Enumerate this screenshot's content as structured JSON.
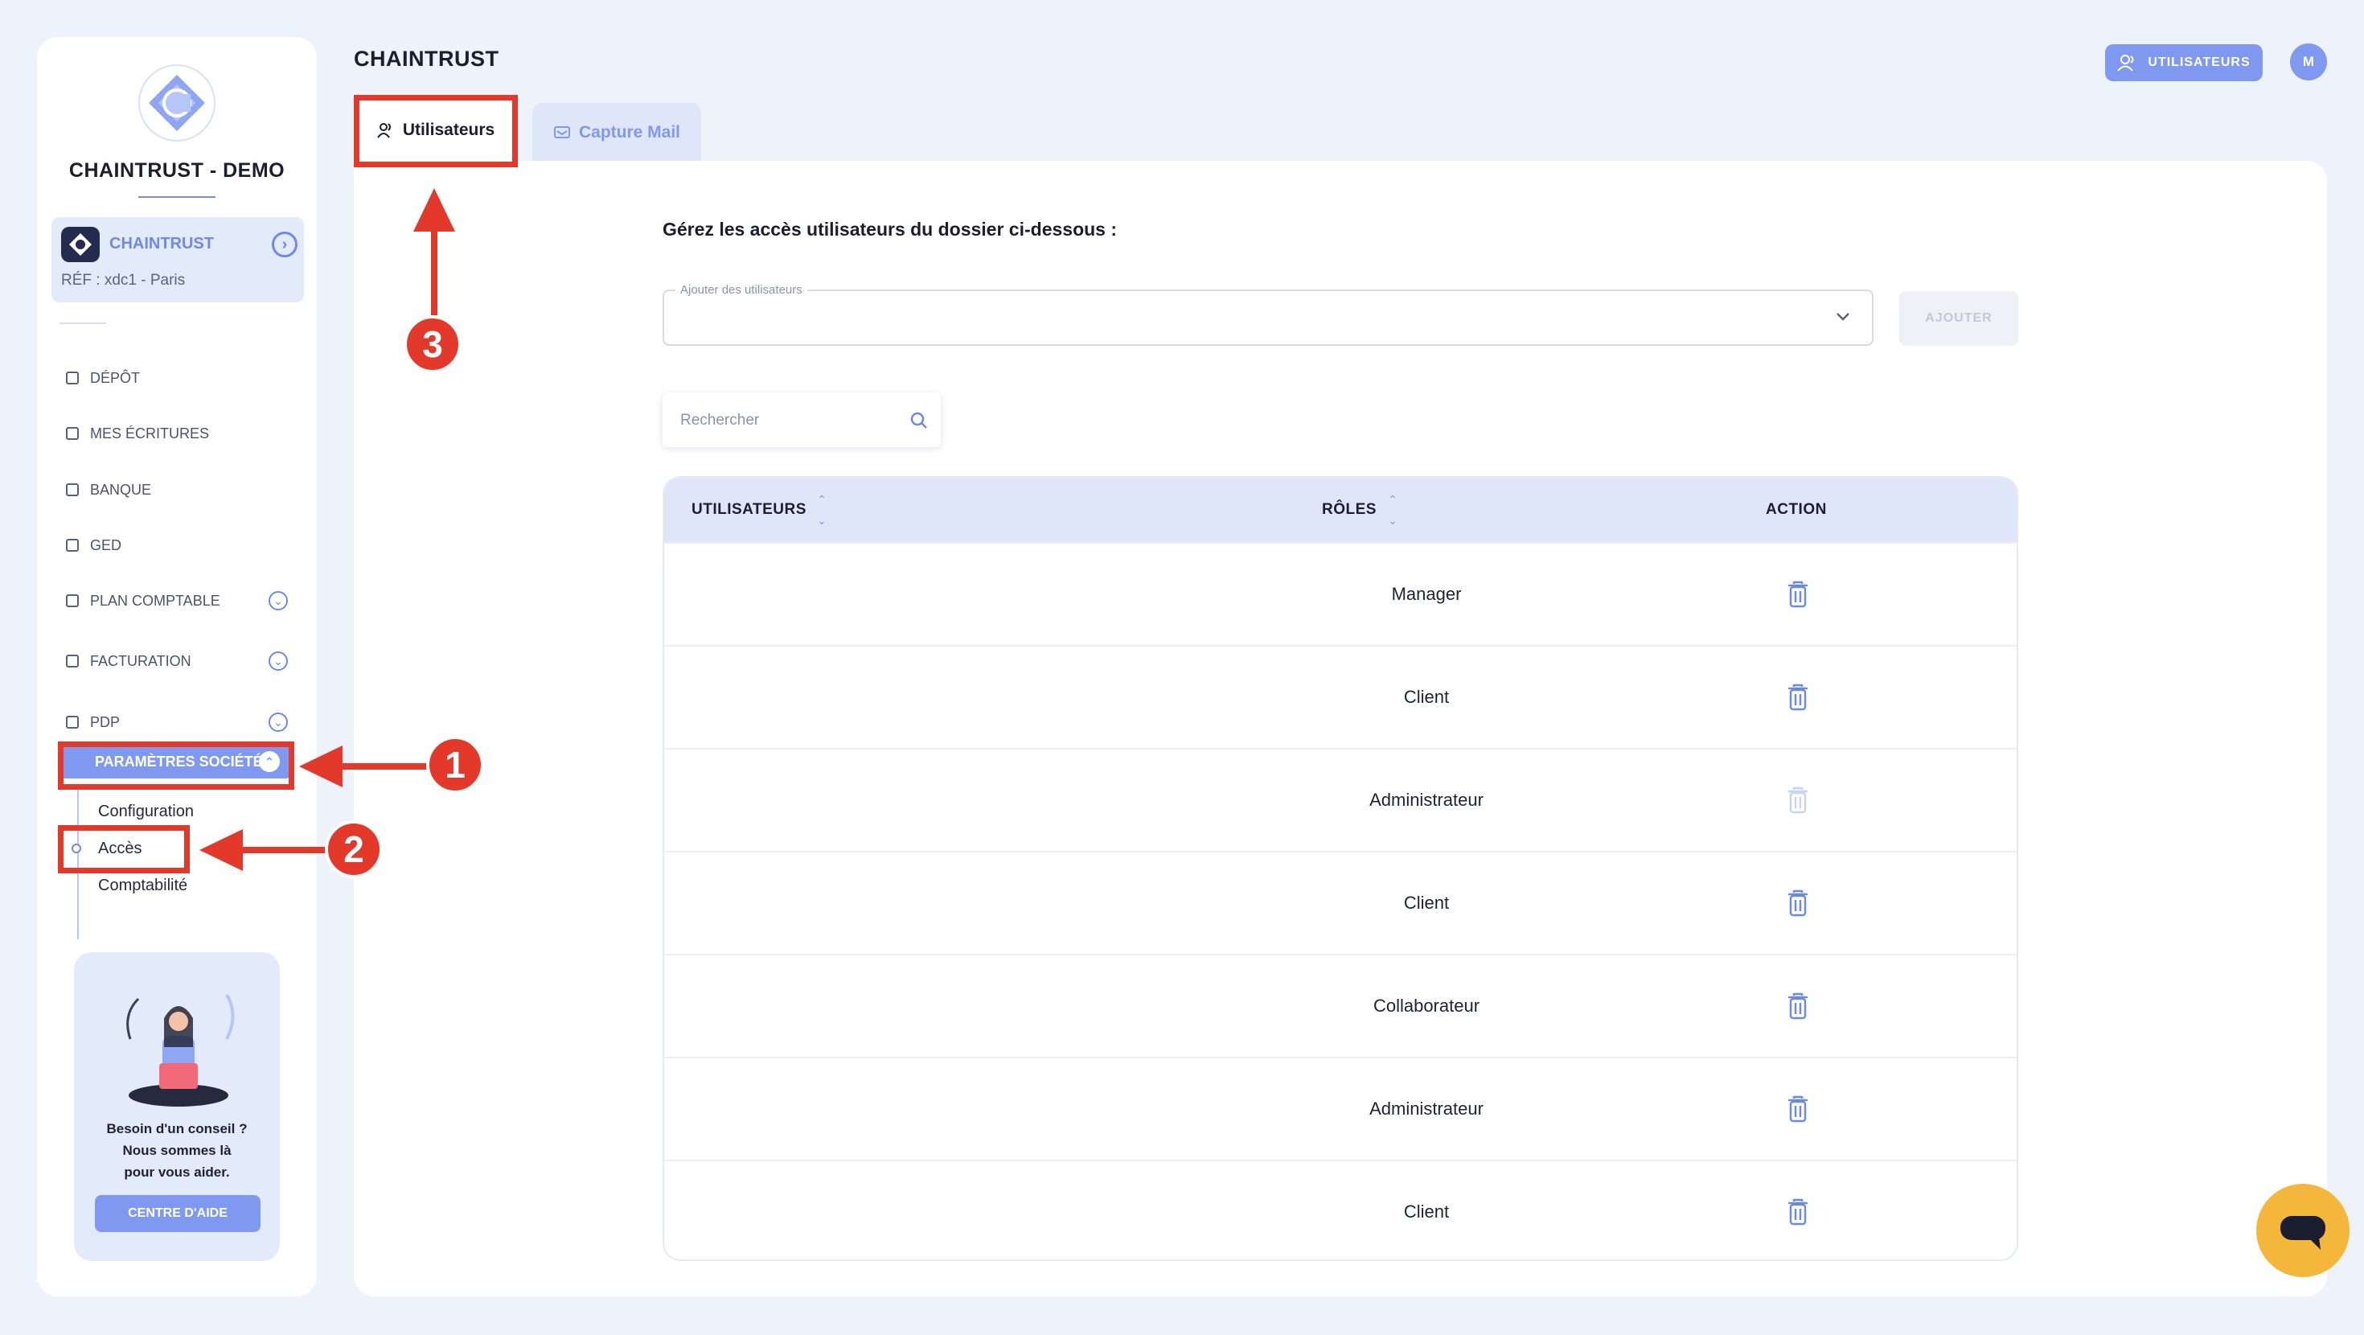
{
  "app": {
    "title": "CHAINTRUST"
  },
  "header": {
    "users_button": "UTILISATEURS",
    "avatar_initial": "M"
  },
  "tabs": [
    {
      "label": "Utilisateurs",
      "active": true
    },
    {
      "label": "Capture Mail",
      "active": false
    }
  ],
  "sidebar": {
    "company": "CHAINTRUST - DEMO",
    "entity": {
      "name": "CHAINTRUST",
      "ref": "RÉF : xdc1 - Paris"
    },
    "items": [
      {
        "label": "DÉPÔT",
        "expandable": false
      },
      {
        "label": "MES ÉCRITURES",
        "expandable": false
      },
      {
        "label": "BANQUE",
        "expandable": false
      },
      {
        "label": "GED",
        "expandable": false
      },
      {
        "label": "PLAN COMPTABLE",
        "expandable": true
      },
      {
        "label": "FACTURATION",
        "expandable": true
      },
      {
        "label": "PDP",
        "expandable": true
      },
      {
        "label": "PARAMÈTRES SOCIÉTÉ",
        "expandable": true,
        "active": true
      }
    ],
    "subitems": [
      {
        "label": "Configuration"
      },
      {
        "label": "Accès",
        "active": true
      },
      {
        "label": "Comptabilité"
      }
    ],
    "help": {
      "line1": "Besoin d'un conseil ?",
      "line2": "Nous sommes là",
      "line3": "pour vous aider.",
      "button": "CENTRE D'AIDE"
    }
  },
  "main": {
    "instruction": "Gérez les accès utilisateurs du dossier ci-dessous :",
    "add_field_label": "Ajouter des utilisateurs",
    "add_field_value": "",
    "add_button": "AJOUTER",
    "search_placeholder": "Rechercher",
    "search_value": "",
    "table": {
      "columns": [
        "UTILISATEURS",
        "RÔLES",
        "ACTION"
      ],
      "rows": [
        {
          "user": "",
          "role": "Manager",
          "delete_enabled": true
        },
        {
          "user": "",
          "role": "Client",
          "delete_enabled": true
        },
        {
          "user": "",
          "role": "Administrateur",
          "delete_enabled": false
        },
        {
          "user": "",
          "role": "Client",
          "delete_enabled": true
        },
        {
          "user": "",
          "role": "Collaborateur",
          "delete_enabled": true
        },
        {
          "user": "",
          "role": "Administrateur",
          "delete_enabled": true
        },
        {
          "user": "",
          "role": "Client",
          "delete_enabled": true
        }
      ]
    }
  },
  "annotations": {
    "step1": "1",
    "step2": "2",
    "step3": "3"
  },
  "colors": {
    "accent": "#7f99f0",
    "annotation": "#e2392b",
    "chat": "#f4b73c",
    "background": "#eef2fa"
  }
}
